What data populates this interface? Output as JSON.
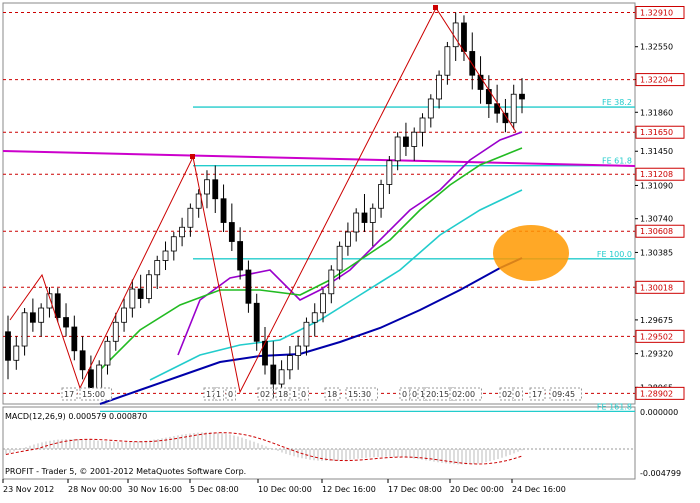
{
  "chart_data": {
    "type": "candlestick",
    "price_axis": {
      "ticks": [
        "1.32550",
        "1.32205",
        "1.31860",
        "1.31450",
        "1.31090",
        "1.30740",
        "1.30385",
        "1.29675",
        "1.29320",
        "1.28965"
      ],
      "ylim": [
        1.2879,
        1.3301
      ]
    },
    "price_levels": [
      {
        "label": "1.32910",
        "value": 1.3291,
        "style": "red-box"
      },
      {
        "label": "1.32204",
        "value": 1.32204,
        "style": "red-box"
      },
      {
        "label": "1.31650",
        "value": 1.3165,
        "style": "red-box"
      },
      {
        "label": "1.31208",
        "value": 1.31208,
        "style": "red-box"
      },
      {
        "label": "1.30608",
        "value": 1.30608,
        "style": "red-box"
      },
      {
        "label": "1.30018",
        "value": 1.30018,
        "style": "red-box"
      },
      {
        "label": "1.29502",
        "value": 1.29502,
        "style": "red-box"
      },
      {
        "label": "1.28902",
        "value": 1.28902,
        "style": "red-box"
      }
    ],
    "fibo_levels": [
      {
        "label": "FE 38.2",
        "value": 1.31915
      },
      {
        "label": "FE 61.8",
        "value": 1.31298
      },
      {
        "label": "FE 100.0",
        "value": 1.30318
      },
      {
        "label": "FE 161.8",
        "value": 1.28712
      }
    ],
    "time_axis": [
      "23 Nov 2012",
      "28 Nov 00:00",
      "30 Nov 16:00",
      "5 Dec 08:00",
      "10 Dec 00:00",
      "12 Dec 16:00",
      "17 Dec 08:00",
      "20 Dec 00:00",
      "24 Dec 16:00"
    ],
    "time_marks": [
      "17",
      "15:00",
      "17",
      "1",
      "0",
      "02",
      "18",
      "1",
      "0",
      "18",
      "15:30",
      "0",
      "0",
      "1",
      "20:15",
      "02:00",
      "02",
      "0",
      "17",
      "09:45"
    ],
    "candles": [
      [
        1.2955,
        1.2972,
        1.2905,
        1.2925
      ],
      [
        1.2925,
        1.295,
        1.2915,
        1.294
      ],
      [
        1.294,
        1.298,
        1.293,
        1.2975
      ],
      [
        1.2975,
        1.299,
        1.2955,
        1.2965
      ],
      [
        1.2965,
        1.2985,
        1.295,
        1.298
      ],
      [
        1.298,
        1.3002,
        1.297,
        1.2995
      ],
      [
        1.2995,
        1.3001,
        1.2965,
        1.297
      ],
      [
        1.297,
        1.2985,
        1.295,
        1.296
      ],
      [
        1.296,
        1.2972,
        1.2925,
        1.2935
      ],
      [
        1.2935,
        1.295,
        1.2905,
        1.2915
      ],
      [
        1.2915,
        1.293,
        1.2883,
        1.2895
      ],
      [
        1.2895,
        1.2925,
        1.2888,
        1.292
      ],
      [
        1.292,
        1.295,
        1.291,
        1.2945
      ],
      [
        1.2945,
        1.2975,
        1.2935,
        1.2965
      ],
      [
        1.2965,
        1.299,
        1.2955,
        1.298
      ],
      [
        1.298,
        1.301,
        1.297,
        1.3
      ],
      [
        1.3,
        1.3015,
        1.298,
        1.299
      ],
      [
        1.299,
        1.302,
        1.2985,
        1.3015
      ],
      [
        1.3015,
        1.3035,
        1.3,
        1.303
      ],
      [
        1.303,
        1.305,
        1.302,
        1.304
      ],
      [
        1.304,
        1.306,
        1.303,
        1.3055
      ],
      [
        1.3055,
        1.3075,
        1.3045,
        1.3065
      ],
      [
        1.3065,
        1.309,
        1.3055,
        1.3085
      ],
      [
        1.3085,
        1.3105,
        1.3075,
        1.31
      ],
      [
        1.31,
        1.3125,
        1.3085,
        1.3115
      ],
      [
        1.3115,
        1.313,
        1.308,
        1.3095
      ],
      [
        1.3095,
        1.311,
        1.306,
        1.307
      ],
      [
        1.307,
        1.309,
        1.304,
        1.305
      ],
      [
        1.305,
        1.3065,
        1.301,
        1.302
      ],
      [
        1.302,
        1.303,
        1.2975,
        1.2985
      ],
      [
        1.2985,
        1.2995,
        1.2935,
        1.2945
      ],
      [
        1.2945,
        1.296,
        1.291,
        1.292
      ],
      [
        1.292,
        1.2945,
        1.2885,
        1.29
      ],
      [
        1.29,
        1.2925,
        1.289,
        1.2915
      ],
      [
        1.2915,
        1.294,
        1.2905,
        1.293
      ],
      [
        1.293,
        1.295,
        1.2915,
        1.294
      ],
      [
        1.294,
        1.297,
        1.293,
        1.2965
      ],
      [
        1.2965,
        1.2985,
        1.295,
        1.2975
      ],
      [
        1.2975,
        1.3,
        1.2965,
        1.2995
      ],
      [
        1.2995,
        1.3025,
        1.2985,
        1.302
      ],
      [
        1.302,
        1.305,
        1.301,
        1.3045
      ],
      [
        1.3045,
        1.307,
        1.3035,
        1.306
      ],
      [
        1.306,
        1.3085,
        1.305,
        1.308
      ],
      [
        1.308,
        1.31,
        1.306,
        1.307
      ],
      [
        1.307,
        1.309,
        1.3045,
        1.3085
      ],
      [
        1.3085,
        1.3115,
        1.3075,
        1.311
      ],
      [
        1.311,
        1.314,
        1.31,
        1.3135
      ],
      [
        1.3135,
        1.3165,
        1.3125,
        1.316
      ],
      [
        1.316,
        1.3175,
        1.314,
        1.315
      ],
      [
        1.315,
        1.317,
        1.3135,
        1.3165
      ],
      [
        1.3165,
        1.3185,
        1.315,
        1.318
      ],
      [
        1.318,
        1.3205,
        1.317,
        1.32
      ],
      [
        1.32,
        1.323,
        1.319,
        1.3225
      ],
      [
        1.3225,
        1.326,
        1.3215,
        1.3255
      ],
      [
        1.3255,
        1.3291,
        1.324,
        1.328
      ],
      [
        1.328,
        1.3288,
        1.324,
        1.325
      ],
      [
        1.325,
        1.327,
        1.321,
        1.3225
      ],
      [
        1.3225,
        1.3245,
        1.3195,
        1.321
      ],
      [
        1.321,
        1.3225,
        1.318,
        1.3195
      ],
      [
        1.3195,
        1.3215,
        1.3175,
        1.3185
      ],
      [
        1.3185,
        1.32,
        1.3165,
        1.3175
      ],
      [
        1.3175,
        1.3215,
        1.3168,
        1.3205
      ],
      [
        1.3205,
        1.3222,
        1.3185,
        1.32
      ]
    ],
    "indicator": {
      "name": "MACD(12,26,9)",
      "values": [
        "0.000579",
        "0.000870"
      ],
      "axis_ticks": [
        "0.000000",
        "-0.004799"
      ]
    }
  },
  "footer": {
    "copyright": "PROFIT - Trader 5, © 2001-2012 MetaQuotes Software Corp."
  },
  "colors": {
    "grid": "#cc0000",
    "candle": "#000000",
    "zigzag": "#cc0000",
    "fibo": "#22cccc",
    "trendline": "#cc00cc",
    "ma_fast": "#9900cc",
    "ma_mid": "#22bb22",
    "ma_slow": "#22cccc",
    "ma_long": "#0000aa",
    "highlight": "#ff9900"
  }
}
